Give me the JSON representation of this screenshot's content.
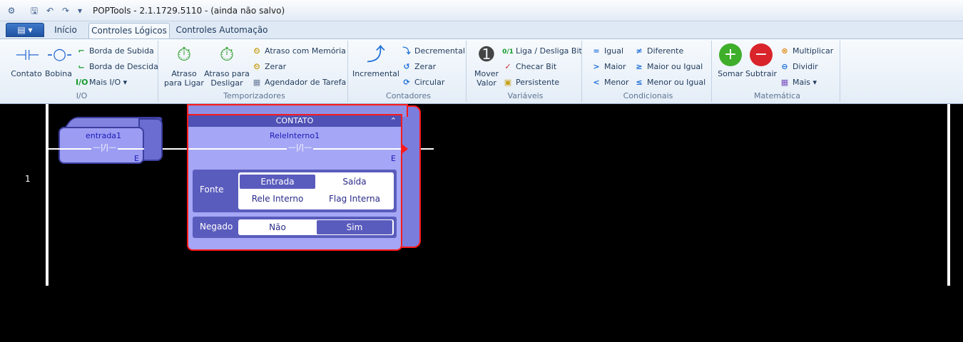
{
  "window": {
    "title": "POPTools - 2.1.1729.5110 - (ainda não salvo)"
  },
  "tabs": [
    {
      "label": "Início"
    },
    {
      "label": "Controles Lógicos"
    },
    {
      "label": "Controles Automação"
    }
  ],
  "groups": {
    "io": {
      "label": "I/O",
      "contato": "Contato",
      "bobina": "Bobina",
      "subida": "Borda de Subida",
      "descida": "Borda de Descida",
      "mais": "Mais I/O"
    },
    "temp": {
      "label": "Temporizadores",
      "ligar1": "Atraso",
      "ligar2": "para Ligar",
      "desligar1": "Atraso para",
      "desligar2": "Desligar",
      "memoria": "Atraso com Memória",
      "zerar": "Zerar",
      "agendador": "Agendador de Tarefa"
    },
    "cont": {
      "label": "Contadores",
      "incremental": "Incremental",
      "decremental": "Decremental",
      "zerar": "Zerar",
      "circular": "Circular"
    },
    "var": {
      "label": "Variáveis",
      "mover1": "Mover",
      "mover2": "Valor",
      "liga": "Liga / Desliga Bit",
      "checar": "Checar Bit",
      "persistente": "Persistente"
    },
    "cond": {
      "label": "Condicionais",
      "igual": "Igual",
      "maior": "Maior",
      "menor": "Menor",
      "diferente": "Diferente",
      "maiorigual": "Maior ou Igual",
      "menorigual": "Menor ou Igual"
    },
    "mat": {
      "label": "Matemática",
      "somar": "Somar",
      "subtrair": "Subtrair",
      "multiplicar": "Multiplicar",
      "dividir": "Dividir",
      "mais": "Mais"
    }
  },
  "ladder": {
    "rung_number": "1",
    "element1": {
      "name": "entrada1",
      "symbol": "—|/|—",
      "type": "E"
    },
    "card": {
      "header": "CONTATO",
      "name": "ReleInterno1",
      "symbol": "—|/|—",
      "type": "E",
      "fonte_label": "Fonte",
      "fonte_options": [
        "Entrada",
        "Saída",
        "Rele Interno",
        "Flag Interna"
      ],
      "fonte_selected": "Entrada",
      "negado_label": "Negado",
      "negado_options": [
        "Não",
        "Sim"
      ],
      "negado_selected": "Sim"
    }
  }
}
